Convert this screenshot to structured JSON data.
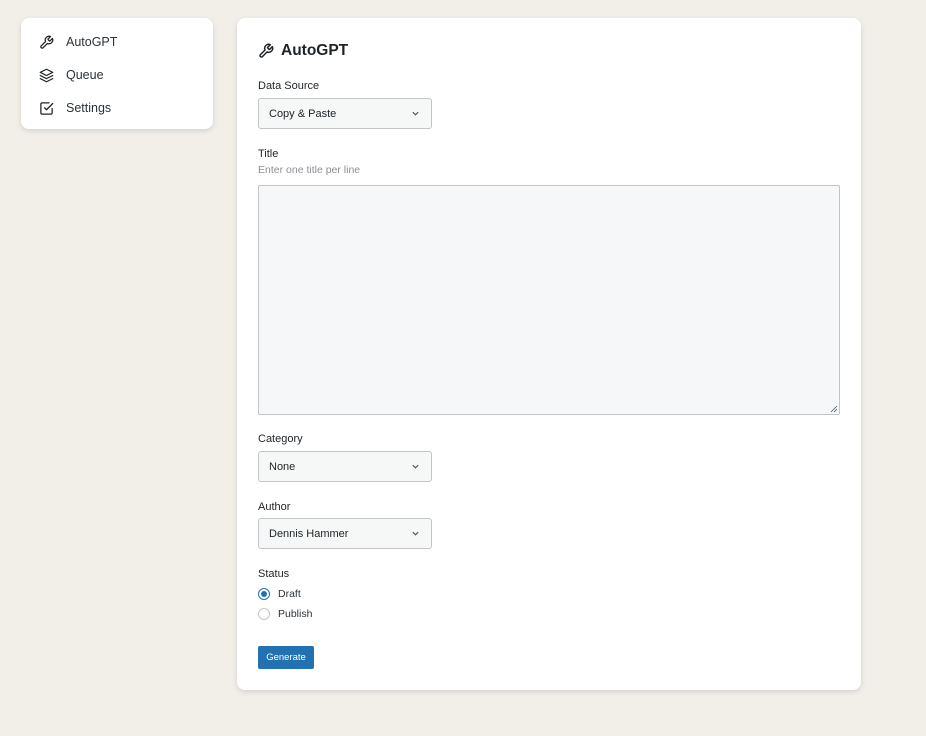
{
  "sidebar": {
    "items": [
      {
        "label": "AutoGPT",
        "icon": "wrench-icon"
      },
      {
        "label": "Queue",
        "icon": "layers-icon"
      },
      {
        "label": "Settings",
        "icon": "checkbox-icon"
      }
    ]
  },
  "main": {
    "title": "AutoGPT",
    "title_icon": "wrench-icon",
    "data_source": {
      "label": "Data Source",
      "value": "Copy & Paste"
    },
    "title_field": {
      "label": "Title",
      "hint": "Enter one title per line",
      "value": ""
    },
    "category": {
      "label": "Category",
      "value": "None"
    },
    "author": {
      "label": "Author",
      "value": "Dennis Hammer"
    },
    "status": {
      "label": "Status",
      "options": [
        {
          "label": "Draft",
          "checked": true
        },
        {
          "label": "Publish",
          "checked": false
        }
      ]
    },
    "generate_label": "Generate"
  },
  "colors": {
    "background": "#f1efe8",
    "accent": "#2271b1",
    "panel": "#ffffff"
  }
}
